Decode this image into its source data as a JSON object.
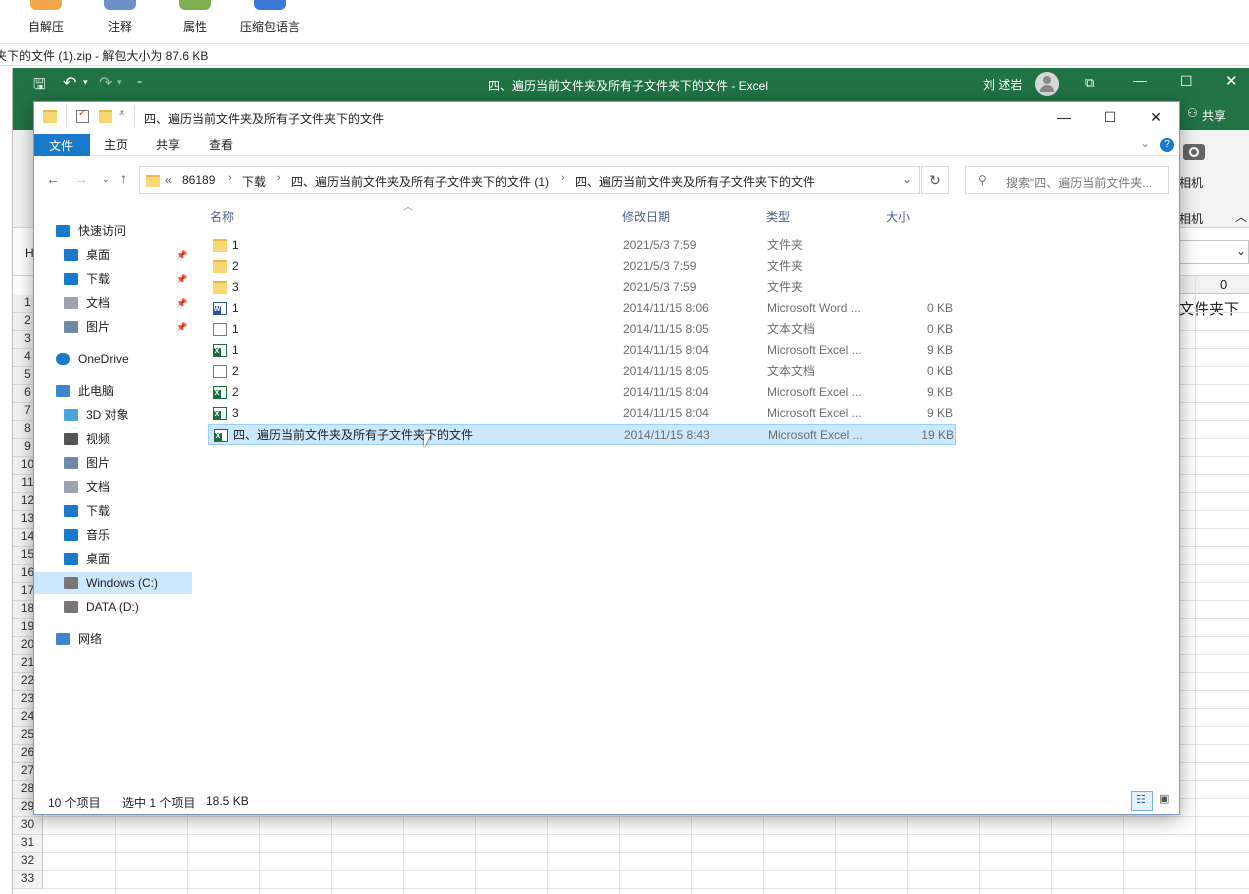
{
  "zip_toolbar": {
    "tools": [
      {
        "label": "自解压",
        "icon": "self-extract-icon"
      },
      {
        "label": "注释",
        "icon": "comment-icon"
      },
      {
        "label": "属性",
        "icon": "properties-icon"
      },
      {
        "label": "压缩包语言",
        "icon": "archive-language-icon"
      }
    ],
    "info": "夹下的文件 (1).zip - 解包大小为 87.6 KB"
  },
  "excel": {
    "title": "四、遍历当前文件夹及所有子文件夹下的文件  -  Excel",
    "user": "刘 述岩",
    "share": "共享",
    "camera_label": "相机",
    "camera_label2": "相机",
    "cell_text": "文件夹下",
    "col_value": "0",
    "name_box_prefix": "H",
    "row_numbers": [
      "1",
      "2",
      "3",
      "4",
      "5",
      "6",
      "7",
      "8",
      "9",
      "10",
      "11",
      "12",
      "13",
      "14",
      "15",
      "16",
      "17",
      "18",
      "19",
      "20",
      "21",
      "22",
      "23",
      "24",
      "25",
      "26",
      "27",
      "28",
      "29",
      "30",
      "31",
      "32",
      "33"
    ]
  },
  "explorer": {
    "title": "四、遍历当前文件夹及所有子文件夹下的文件",
    "menu": [
      "文件",
      "主页",
      "共享",
      "查看"
    ],
    "address": [
      "86189",
      "下载",
      "四、遍历当前文件夹及所有子文件夹下的文件 (1)",
      "四、遍历当前文件夹及所有子文件夹下的文件"
    ],
    "address_prefix": "«",
    "search_placeholder": "搜索\"四、遍历当前文件夹...",
    "nav": [
      {
        "label": "快速访问",
        "icon": "star-icon",
        "indent": 0,
        "pinned": false
      },
      {
        "label": "桌面",
        "icon": "desktop-icon",
        "indent": 1,
        "pinned": true
      },
      {
        "label": "下载",
        "icon": "download-icon",
        "indent": 1,
        "pinned": true
      },
      {
        "label": "文档",
        "icon": "document-icon",
        "indent": 1,
        "pinned": true
      },
      {
        "label": "图片",
        "icon": "picture-icon",
        "indent": 1,
        "pinned": true
      },
      {
        "label": "OneDrive",
        "icon": "cloud-icon",
        "indent": 0,
        "pinned": false
      },
      {
        "label": "此电脑",
        "icon": "computer-icon",
        "indent": 0,
        "pinned": false
      },
      {
        "label": "3D 对象",
        "icon": "cube-icon",
        "indent": 1,
        "pinned": false
      },
      {
        "label": "视频",
        "icon": "video-icon",
        "indent": 1,
        "pinned": false
      },
      {
        "label": "图片",
        "icon": "picture-icon",
        "indent": 1,
        "pinned": false
      },
      {
        "label": "文档",
        "icon": "document-icon",
        "indent": 1,
        "pinned": false
      },
      {
        "label": "下载",
        "icon": "download-icon",
        "indent": 1,
        "pinned": false
      },
      {
        "label": "音乐",
        "icon": "music-icon",
        "indent": 1,
        "pinned": false
      },
      {
        "label": "桌面",
        "icon": "desktop-icon",
        "indent": 1,
        "pinned": false
      },
      {
        "label": "Windows (C:)",
        "icon": "drive-icon",
        "indent": 1,
        "pinned": false,
        "selected": true
      },
      {
        "label": "DATA (D:)",
        "icon": "drive-icon",
        "indent": 1,
        "pinned": false
      },
      {
        "label": "网络",
        "icon": "network-icon",
        "indent": 0,
        "pinned": false
      }
    ],
    "columns": {
      "name": "名称",
      "date": "修改日期",
      "type": "类型",
      "size": "大小"
    },
    "files": [
      {
        "name": "1",
        "date": "2021/5/3 7:59",
        "type": "文件夹",
        "size": "",
        "icon": "folder"
      },
      {
        "name": "2",
        "date": "2021/5/3 7:59",
        "type": "文件夹",
        "size": "",
        "icon": "folder"
      },
      {
        "name": "3",
        "date": "2021/5/3 7:59",
        "type": "文件夹",
        "size": "",
        "icon": "folder"
      },
      {
        "name": "1",
        "date": "2014/11/15 8:06",
        "type": "Microsoft Word ...",
        "size": "0 KB",
        "icon": "word"
      },
      {
        "name": "1",
        "date": "2014/11/15 8:05",
        "type": "文本文档",
        "size": "0 KB",
        "icon": "text"
      },
      {
        "name": "1",
        "date": "2014/11/15 8:04",
        "type": "Microsoft Excel ...",
        "size": "9 KB",
        "icon": "excel"
      },
      {
        "name": "2",
        "date": "2014/11/15 8:05",
        "type": "文本文档",
        "size": "0 KB",
        "icon": "text"
      },
      {
        "name": "2",
        "date": "2014/11/15 8:04",
        "type": "Microsoft Excel ...",
        "size": "9 KB",
        "icon": "excel"
      },
      {
        "name": "3",
        "date": "2014/11/15 8:04",
        "type": "Microsoft Excel ...",
        "size": "9 KB",
        "icon": "excel"
      },
      {
        "name": "四、遍历当前文件夹及所有子文件夹下的文件",
        "date": "2014/11/15 8:43",
        "type": "Microsoft Excel ...",
        "size": "19 KB",
        "icon": "excel",
        "selected": true
      }
    ],
    "status": {
      "count": "10 个项目",
      "selection": "选中 1 个项目",
      "size": "18.5 KB"
    },
    "colors": {
      "accent": "#0063b1",
      "selection": "#cce8ff",
      "excel_green": "#217346"
    }
  }
}
